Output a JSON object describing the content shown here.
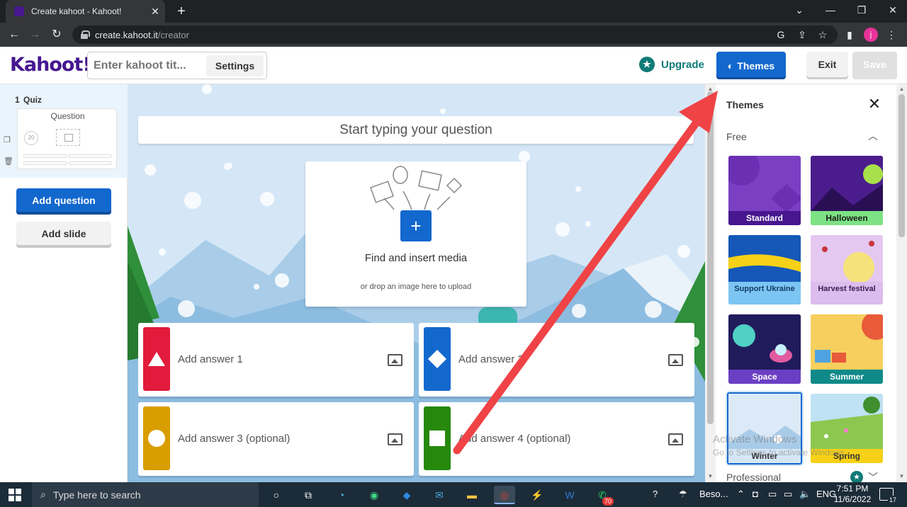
{
  "browser": {
    "tab_title": "Create kahoot - Kahoot!",
    "new_tab": "+",
    "url_host": "create.kahoot.it",
    "url_path": "/creator",
    "profile_initial": "j"
  },
  "header": {
    "logo": "Kahoot!",
    "title_placeholder": "Enter kahoot tit...",
    "settings_label": "Settings",
    "upgrade_label": "Upgrade",
    "themes_label": "Themes",
    "exit_label": "Exit",
    "save_label": "Save"
  },
  "sidebar": {
    "slide_number": "1",
    "slide_type": "Quiz",
    "thumb_label": "Question",
    "thumb_timer": "20",
    "add_question": "Add question",
    "add_slide": "Add slide"
  },
  "editor": {
    "question_placeholder": "Start typing your question",
    "media_title": "Find and insert media",
    "media_subtitle": "or drop an image here to upload",
    "answers": [
      {
        "label": "Add answer 1",
        "color": "#e21b3c",
        "shape": "triangle"
      },
      {
        "label": "Add answer 2",
        "color": "#1368ce",
        "shape": "diamond"
      },
      {
        "label": "Add answer 3 (optional)",
        "color": "#d89e00",
        "shape": "circle"
      },
      {
        "label": "Add answer 4 (optional)",
        "color": "#26890c",
        "shape": "square"
      }
    ]
  },
  "themes_panel": {
    "title": "Themes",
    "section_free": "Free",
    "section_professional": "Professional",
    "themes": [
      {
        "name": "Standard"
      },
      {
        "name": "Halloween"
      },
      {
        "name": "Support Ukraine"
      },
      {
        "name": "Harvest festival"
      },
      {
        "name": "Space"
      },
      {
        "name": "Summer"
      },
      {
        "name": "Winter",
        "selected": true
      },
      {
        "name": "Spring"
      }
    ]
  },
  "watermark": {
    "line1": "Activate Windows",
    "line2": "Go to Settings to activate Windows."
  },
  "taskbar": {
    "search_placeholder": "Type here to search",
    "weather": "Beso...",
    "time": "7:51 PM",
    "date": "11/6/2022",
    "notification_count": "17",
    "whatsapp_badge": "70"
  },
  "colors": {
    "kahoot_purple": "#46178f",
    "primary_blue": "#1368ce",
    "upgrade_teal": "#0f7a77",
    "annotation_red": "#ef4346"
  }
}
